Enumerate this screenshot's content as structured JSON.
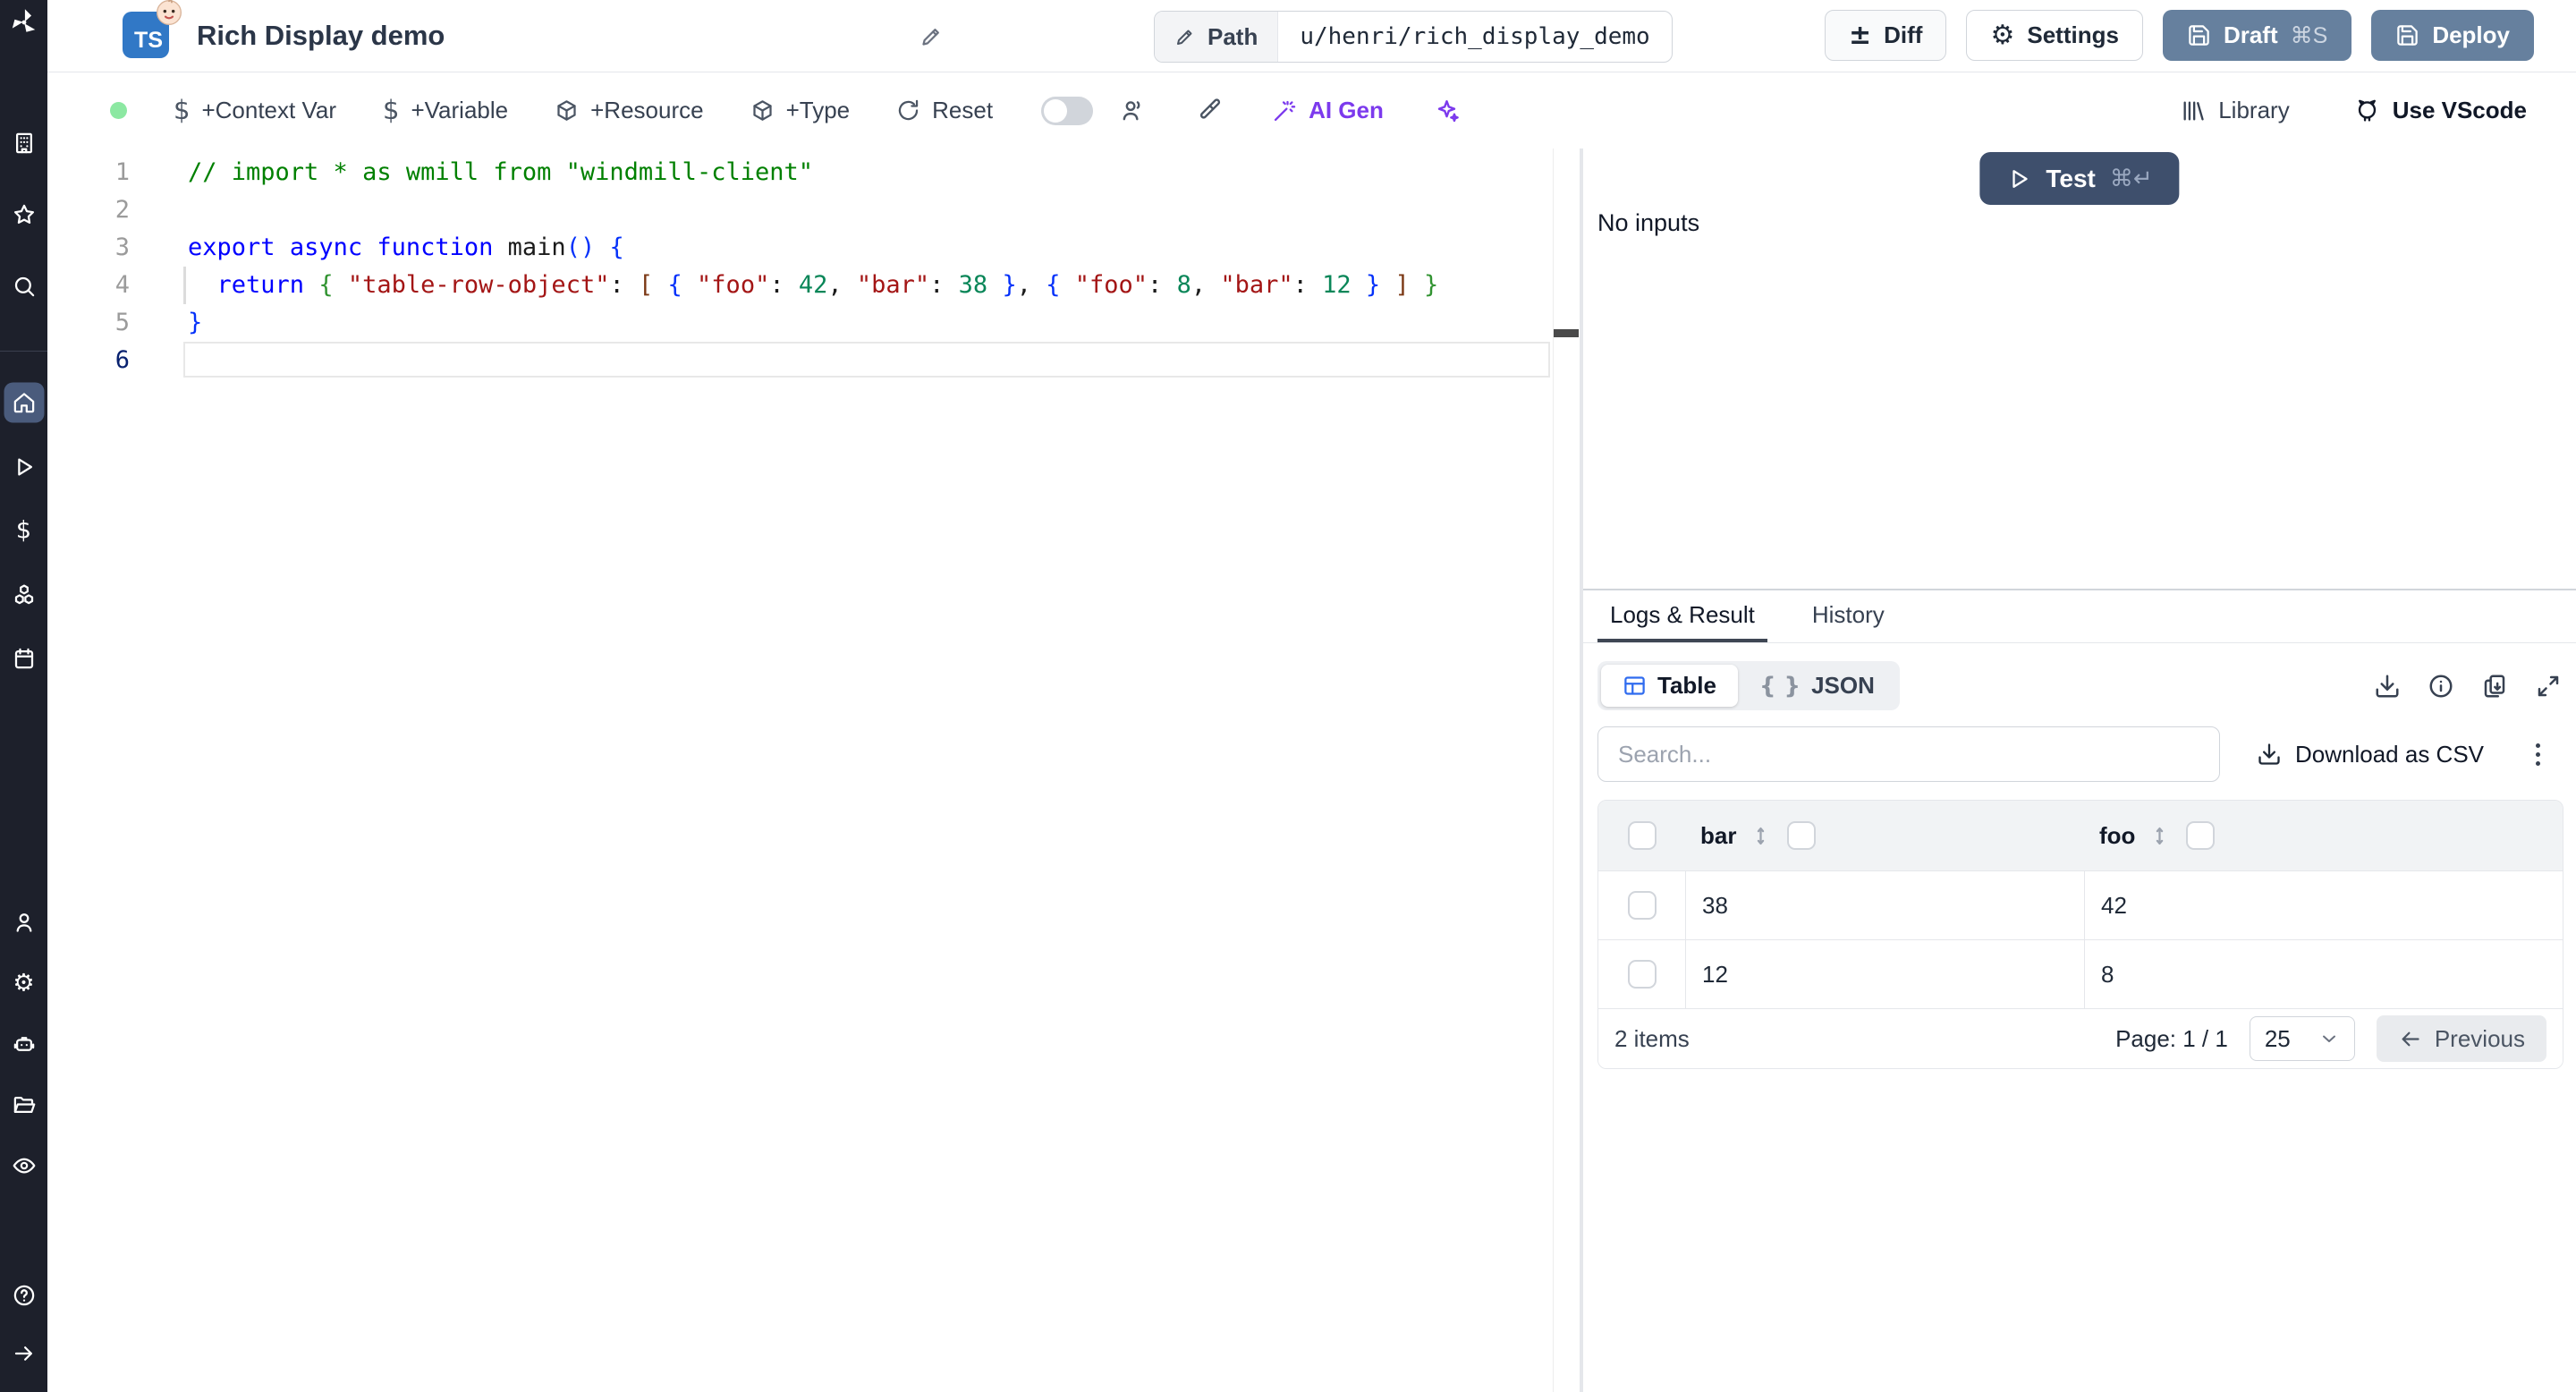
{
  "colors": {
    "sidebar_bg": "#1d202b",
    "sidebar_active": "#4a5b7c",
    "primary_button": "#66809e",
    "test_button": "#3e4f6c",
    "ai_purple": "#7c3aed",
    "status_green": "#8ce8a2",
    "table_icon_blue": "#2f6bef",
    "ts_badge_blue": "#3178c6"
  },
  "sidebar": {
    "top_items": [
      {
        "icon": "building"
      },
      {
        "icon": "star"
      },
      {
        "icon": "search"
      }
    ],
    "main_items": [
      {
        "icon": "home",
        "active": true
      },
      {
        "icon": "play"
      },
      {
        "icon": "dollar"
      },
      {
        "icon": "cubes"
      },
      {
        "icon": "calendar"
      }
    ],
    "bottom_items": [
      {
        "icon": "person"
      },
      {
        "icon": "gear"
      },
      {
        "icon": "robot"
      },
      {
        "icon": "folder-open"
      },
      {
        "icon": "eye"
      }
    ],
    "footer_items": [
      {
        "icon": "help-circle"
      },
      {
        "icon": "arrow-right"
      }
    ]
  },
  "header": {
    "badge": "TS",
    "title": "Rich Display demo",
    "path_label": "Path",
    "path_value": "u/henri/rich_display_demo",
    "buttons": {
      "diff": "Diff",
      "settings": "Settings",
      "draft": "Draft",
      "draft_shortcut": "⌘S",
      "deploy": "Deploy"
    }
  },
  "toolbar": {
    "left": [
      {
        "icon": "dollar",
        "label": "+Context Var"
      },
      {
        "icon": "dollar",
        "label": "+Variable"
      },
      {
        "icon": "package",
        "label": "+Resource"
      },
      {
        "icon": "package",
        "label": "+Type"
      },
      {
        "icon": "reset",
        "label": "Reset"
      }
    ],
    "ai_gen": "AI Gen",
    "library": "Library",
    "vscode": "Use VScode"
  },
  "editor": {
    "lines": [
      {
        "no": "1",
        "segs": [
          [
            "c",
            "// import * as wmill from \"windmill-client\""
          ]
        ]
      },
      {
        "no": "2",
        "segs": []
      },
      {
        "no": "3",
        "segs": [
          [
            "k",
            "export"
          ],
          [
            "p",
            " "
          ],
          [
            "k",
            "async"
          ],
          [
            "p",
            " "
          ],
          [
            "k",
            "function"
          ],
          [
            "p",
            " main"
          ],
          [
            "b1",
            "()"
          ],
          [
            "p",
            " "
          ],
          [
            "b1",
            "{"
          ]
        ]
      },
      {
        "no": "4",
        "segs": [
          [
            "p",
            "  "
          ],
          [
            "k",
            "return"
          ],
          [
            "p",
            " "
          ],
          [
            "b2",
            "{"
          ],
          [
            "p",
            " "
          ],
          [
            "s",
            "\"table-row-object\""
          ],
          [
            "p",
            ": "
          ],
          [
            "b3",
            "["
          ],
          [
            "p",
            " "
          ],
          [
            "b1",
            "{"
          ],
          [
            "p",
            " "
          ],
          [
            "s",
            "\"foo\""
          ],
          [
            "p",
            ": "
          ],
          [
            "n",
            "42"
          ],
          [
            "p",
            ", "
          ],
          [
            "s",
            "\"bar\""
          ],
          [
            "p",
            ": "
          ],
          [
            "n",
            "38"
          ],
          [
            "p",
            " "
          ],
          [
            "b1",
            "}"
          ],
          [
            "p",
            ", "
          ],
          [
            "b1",
            "{"
          ],
          [
            "p",
            " "
          ],
          [
            "s",
            "\"foo\""
          ],
          [
            "p",
            ": "
          ],
          [
            "n",
            "8"
          ],
          [
            "p",
            ", "
          ],
          [
            "s",
            "\"bar\""
          ],
          [
            "p",
            ": "
          ],
          [
            "n",
            "12"
          ],
          [
            "p",
            " "
          ],
          [
            "b1",
            "}"
          ],
          [
            "p",
            " "
          ],
          [
            "b3",
            "]"
          ],
          [
            "p",
            " "
          ],
          [
            "b2",
            "}"
          ]
        ]
      },
      {
        "no": "5",
        "segs": [
          [
            "b1",
            "}"
          ]
        ]
      },
      {
        "no": "6",
        "segs": [],
        "current": true
      }
    ]
  },
  "run_panel": {
    "no_inputs": "No inputs",
    "test": "Test",
    "test_shortcut": "⌘↵"
  },
  "results": {
    "tabs": [
      {
        "label": "Logs & Result",
        "active": true
      },
      {
        "label": "History"
      }
    ],
    "views": [
      {
        "label": "Table",
        "icon": "table",
        "active": true
      },
      {
        "label": "JSON",
        "icon": "braces"
      }
    ],
    "action_icons": [
      "download",
      "info",
      "clipboard",
      "expand"
    ],
    "search_placeholder": "Search...",
    "download_csv": "Download as CSV",
    "table": {
      "columns": [
        "bar",
        "foo"
      ],
      "rows": [
        [
          "38",
          "42"
        ],
        [
          "12",
          "8"
        ]
      ],
      "items_count": "2 items",
      "page_info": "Page: 1 / 1",
      "page_size": "25",
      "previous": "Previous"
    }
  }
}
